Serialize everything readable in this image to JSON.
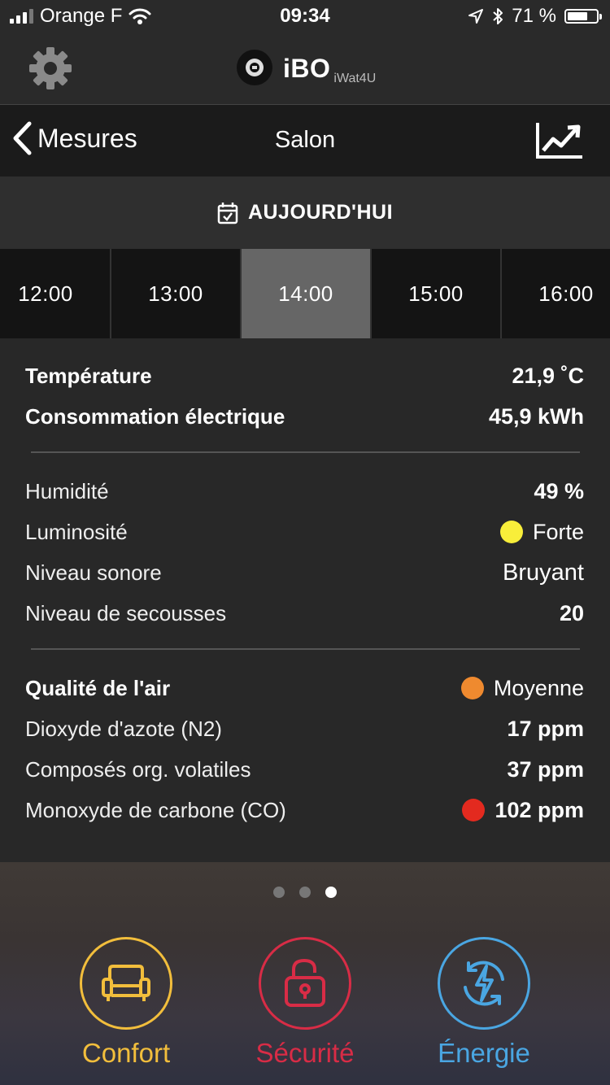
{
  "status": {
    "carrier": "Orange F",
    "time": "09:34",
    "battery": "71 %",
    "battery_level": 0.71
  },
  "header": {
    "app_name": "iBO",
    "app_sub": "iWat4U"
  },
  "nav": {
    "back_label": "Mesures",
    "title": "Salon"
  },
  "date": {
    "label": "AUJOURD'HUI"
  },
  "timeslots": [
    {
      "label": "12:00",
      "active": false
    },
    {
      "label": "13:00",
      "active": false
    },
    {
      "label": "14:00",
      "active": true
    },
    {
      "label": "15:00",
      "active": false
    },
    {
      "label": "16:00",
      "active": false
    }
  ],
  "measures": {
    "temperature": {
      "label": "Température",
      "value": "21,9 ˚C"
    },
    "consumption": {
      "label": "Consommation électrique",
      "value": "45,9 kWh"
    },
    "humidity": {
      "label": "Humidité",
      "value": "49 %"
    },
    "luminosity": {
      "label": "Luminosité",
      "value": "Forte",
      "color": "#f8ee3a"
    },
    "sound": {
      "label": "Niveau sonore",
      "value": "Bruyant"
    },
    "shakes": {
      "label": "Niveau de secousses",
      "value": "20"
    },
    "air_quality": {
      "label": "Qualité de l'air",
      "value": "Moyenne",
      "color": "#ef8a2f"
    },
    "no2": {
      "label": "Dioxyde d'azote (N2)",
      "value": "17 ppm"
    },
    "voc": {
      "label": "Composés org. volatiles",
      "value": "37 ppm"
    },
    "co": {
      "label": "Monoxyde de carbone (CO)",
      "value": "102 ppm",
      "color": "#e32a1f"
    }
  },
  "pager": {
    "count": 3,
    "active": 2
  },
  "tabs": [
    {
      "label": "Confort",
      "color": "#f2be3c",
      "icon": "sofa-icon"
    },
    {
      "label": "Sécurité",
      "color": "#d82c46",
      "icon": "unlocked-padlock-icon"
    },
    {
      "label": "Énergie",
      "color": "#4aa6e2",
      "icon": "energy-bolt-icon"
    }
  ]
}
